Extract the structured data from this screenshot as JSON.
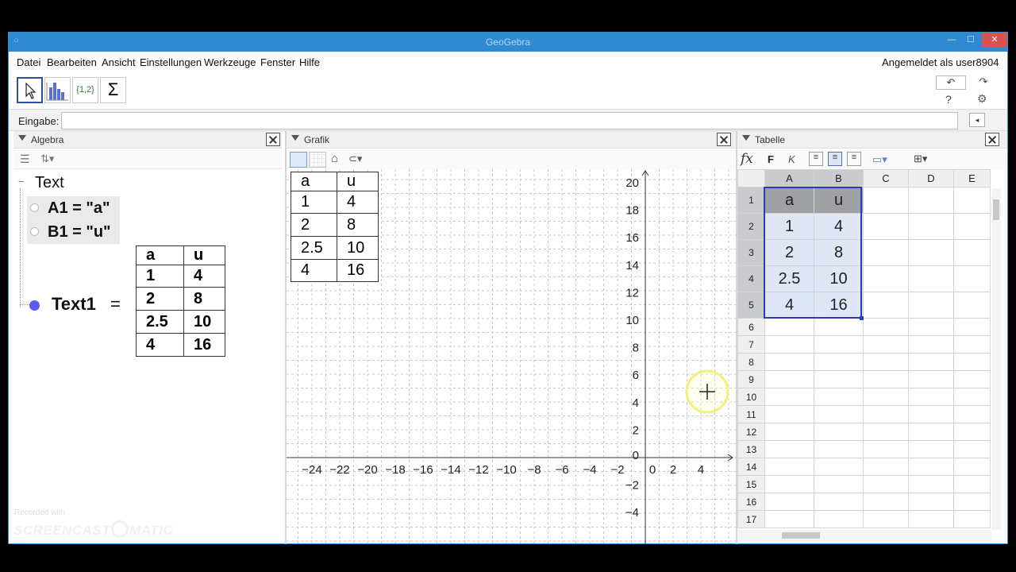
{
  "app": {
    "title": "GeoGebra",
    "user": "Angemeldet als user8904"
  },
  "menu": [
    "Datei",
    "Bearbeiten",
    "Ansicht",
    "Einstellungen",
    "Werkzeuge",
    "Fenster",
    "Hilfe"
  ],
  "toolbar": {
    "list_tool_label": "{1,2}",
    "sum_label": "Σ",
    "help": "?",
    "settings": "⚙"
  },
  "input": {
    "label": "Eingabe:"
  },
  "algebra": {
    "title": "Algebra",
    "group": "Text",
    "items": [
      "A1 = \"a\"",
      "B1 = \"u\""
    ],
    "text1_label": "Text1",
    "equals": "="
  },
  "graphics": {
    "title": "Grafik",
    "x_ticks": [
      "−24",
      "−22",
      "−20",
      "−18",
      "−16",
      "−14",
      "−12",
      "−10",
      "−8",
      "−6",
      "−4",
      "−2",
      "0",
      "2",
      "4"
    ],
    "y_ticks": [
      "20",
      "18",
      "16",
      "14",
      "12",
      "10",
      "8",
      "6",
      "4",
      "2",
      "0",
      "−2",
      "−4"
    ]
  },
  "table": {
    "headers": [
      "a",
      "u"
    ],
    "rows": [
      [
        "1",
        "4"
      ],
      [
        "2",
        "8"
      ],
      [
        "2.5",
        "10"
      ],
      [
        "4",
        "16"
      ]
    ]
  },
  "spreadsheet": {
    "title": "Tabelle",
    "fx": "fx",
    "bold": "F",
    "italic": "K",
    "columns": [
      "A",
      "B",
      "C",
      "D",
      "E"
    ],
    "row_numbers": [
      "1",
      "2",
      "3",
      "4",
      "5",
      "6",
      "7",
      "8",
      "9",
      "10",
      "11",
      "12",
      "13",
      "14",
      "15",
      "16",
      "17"
    ],
    "cells": [
      [
        "a",
        "u"
      ],
      [
        "1",
        "4"
      ],
      [
        "2",
        "8"
      ],
      [
        "2.5",
        "10"
      ],
      [
        "4",
        "16"
      ]
    ]
  },
  "watermark": {
    "line1": "Recorded with",
    "line2": "SCREENCAST",
    "line3": "MATIC"
  },
  "colors": {
    "titlebar": "#2e8ad2",
    "selection": "#2a3bb5",
    "point": "#5b5bf0",
    "cursor_ring": "#f3f07a"
  }
}
